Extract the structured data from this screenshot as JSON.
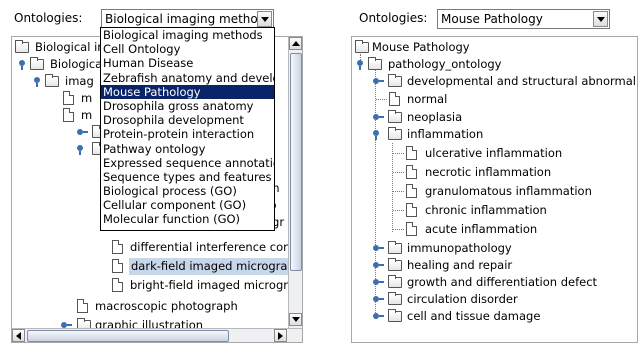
{
  "left": {
    "ontologies_label": "Ontologies:",
    "combo_value": "Biological imaging methods",
    "tree_rows": [
      "Biological im",
      "Biologica",
      "imag",
      "m",
      "m",
      "ph",
      "ro",
      "ogr",
      "differential interference contra",
      "dark-field imaged micrograph",
      "bright-field imaged micrograp",
      "macroscopic photograph",
      "graphic illustration"
    ],
    "dropdown_items": [
      "Biological imaging methods",
      "Cell Ontology",
      "Human Disease",
      "Zebrafish anatomy and developm",
      "Mouse Pathology",
      "Drosophila gross anatomy",
      "Drosophila development",
      "Protein-protein interaction",
      "Pathway ontology",
      "Expressed sequence annotation",
      "Sequence types and features",
      "Biological process (GO)",
      "Cellular component (GO)",
      "Molecular function (GO)"
    ],
    "highlighted_index": 4
  },
  "right": {
    "ontologies_label": "Ontologies:",
    "combo_value": "Mouse Pathology",
    "tree": [
      "Mouse Pathology",
      "pathology_ontology",
      "developmental and structural abnormality",
      "normal",
      "neoplasia",
      "inflammation",
      "ulcerative inflammation",
      "necrotic inflammation",
      "granulomatous inflammation",
      "chronic inflammation",
      "acute inflammation",
      "immunopathology",
      "healing and repair",
      "growth and differentiation defect",
      "circulation disorder",
      "cell and tissue damage"
    ]
  },
  "colors": {
    "highlight": "#0a246a",
    "selection": "#c8d6ea",
    "tree_knob": "#3b6fb0"
  }
}
